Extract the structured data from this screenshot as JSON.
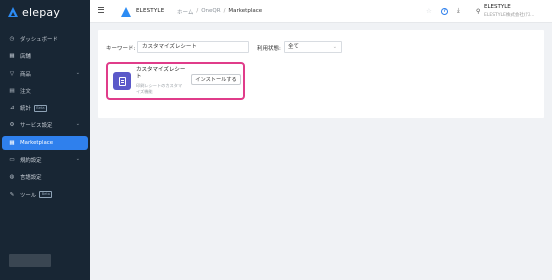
{
  "sidebar": {
    "logo_text": "elepay",
    "items": [
      {
        "label": "ダッシュボード",
        "icon": "dashboard-icon",
        "glyph": "◷",
        "chevron": false,
        "badge": ""
      },
      {
        "label": "店舗",
        "icon": "store-icon",
        "glyph": "▦",
        "chevron": false,
        "badge": ""
      },
      {
        "label": "商品",
        "icon": "product-icon",
        "glyph": "▽",
        "chevron": true,
        "badge": ""
      },
      {
        "label": "注文",
        "icon": "order-icon",
        "glyph": "▤",
        "chevron": false,
        "badge": ""
      },
      {
        "label": "統計",
        "icon": "chart-icon",
        "glyph": "⊿",
        "chevron": false,
        "badge": "Beta"
      },
      {
        "label": "サービス設定",
        "icon": "settings-icon",
        "glyph": "⚙",
        "chevron": true,
        "badge": ""
      },
      {
        "label": "Marketplace",
        "icon": "marketplace-icon",
        "glyph": "▦",
        "chevron": false,
        "badge": "",
        "active": true
      },
      {
        "label": "規約設定",
        "icon": "terms-icon",
        "glyph": "▭",
        "chevron": true,
        "badge": ""
      },
      {
        "label": "言語設定",
        "icon": "language-icon",
        "glyph": "◍",
        "chevron": false,
        "badge": ""
      },
      {
        "label": "ツール",
        "icon": "tool-icon",
        "glyph": "✎",
        "chevron": false,
        "badge": "Beta"
      }
    ]
  },
  "header": {
    "brand": "ELESTYLE",
    "breadcrumb": [
      "ホーム",
      "OneQR",
      "Marketplace"
    ],
    "user_name": "ELESTYLE",
    "user_company": "ELESTYLE株式会社(ﾃｽ..."
  },
  "filters": {
    "keyword_label": "キーワード:",
    "keyword_value": "カスタマイズレシート",
    "status_label": "利用状態:",
    "status_value": "全て"
  },
  "app": {
    "name": "カスタマイズレシート",
    "description": "印刷レシートのカスタマイズ機能",
    "install_label": "インストールする",
    "accent": "#5b59c9",
    "highlight": "#e03c8a"
  },
  "colors": {
    "sidebar_bg": "#182634",
    "active_bg": "#2f80ed"
  }
}
